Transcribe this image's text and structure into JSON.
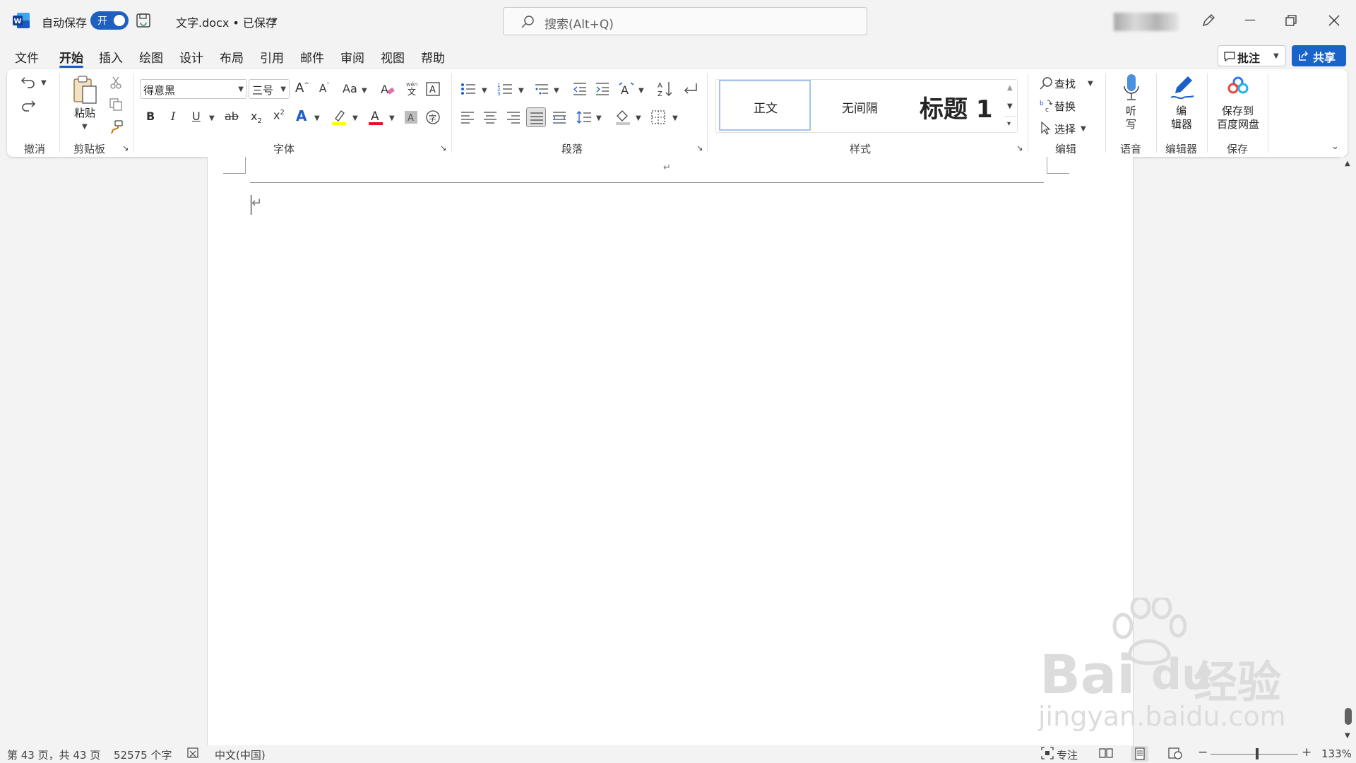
{
  "title_bar": {
    "autosave_label": "自动保存",
    "autosave_toggle": "开",
    "document_title": "文字.docx • 已保存",
    "search_placeholder": "搜索(Alt+Q)"
  },
  "tabs": [
    "文件",
    "开始",
    "插入",
    "绘图",
    "设计",
    "布局",
    "引用",
    "邮件",
    "审阅",
    "视图",
    "帮助"
  ],
  "active_tab": "开始",
  "right_buttons": {
    "comments": "批注",
    "share": "共享"
  },
  "ribbon": {
    "groups": {
      "undo": "撤消",
      "clipboard": "剪贴板",
      "font": "字体",
      "paragraph": "段落",
      "styles": "样式",
      "editing": "编辑",
      "voice": "语音",
      "editor": "编辑器",
      "save": "保存"
    },
    "paste_label": "粘贴",
    "font_name": "得意黑",
    "font_size": "三号",
    "styles": [
      "正文",
      "无间隔",
      "标题 1"
    ],
    "editing": {
      "find": "查找",
      "replace": "替换",
      "select": "选择"
    },
    "dictate": [
      "听",
      "写"
    ],
    "editor_btn": [
      "编",
      "辑器"
    ],
    "save_btn": [
      "保存到",
      "百度网盘"
    ]
  },
  "status_bar": {
    "page": "第 43 页，共 43 页",
    "words": "52575 个字",
    "language": "中文(中国)",
    "focus": "专注",
    "zoom": "133%"
  },
  "watermark": {
    "brand": "Bai",
    "brand2": "du",
    "cn": "经验",
    "url": "jingyan.baidu.com"
  },
  "colors": {
    "accent": "#185abd",
    "highlight": "#ffff00",
    "font_color": "#e81123"
  }
}
